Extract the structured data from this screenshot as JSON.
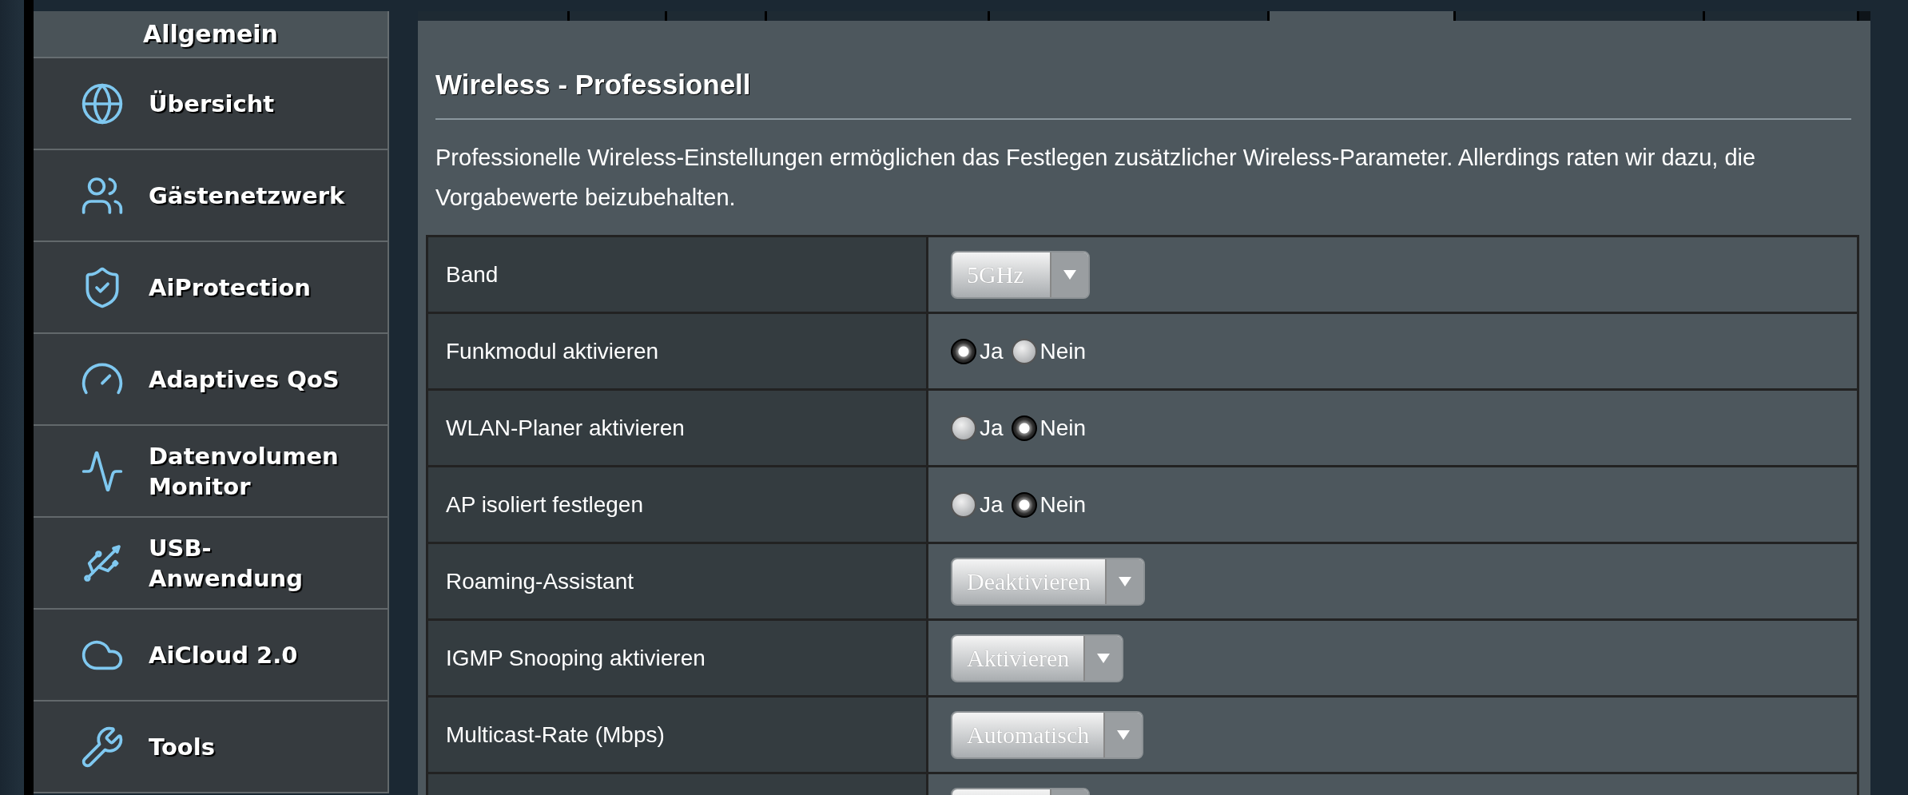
{
  "sidebar": {
    "header": "Allgemein",
    "items": [
      {
        "label": "Übersicht"
      },
      {
        "label": "Gästenetzwerk"
      },
      {
        "label": "AiProtection"
      },
      {
        "label": "Adaptives QoS"
      },
      {
        "label": "Datenvolumen Monitor"
      },
      {
        "label": "USB-Anwendung"
      },
      {
        "label": "AiCloud 2.0"
      },
      {
        "label": "Tools"
      }
    ]
  },
  "tabs": [
    {
      "selected": false
    },
    {
      "selected": false
    },
    {
      "selected": false
    },
    {
      "selected": false
    },
    {
      "selected": false
    },
    {
      "selected": true
    },
    {
      "selected": false
    },
    {
      "selected": false
    }
  ],
  "panel": {
    "title": "Wireless - Professionell",
    "description": "Professionelle Wireless-Einstellungen ermöglichen das Festlegen zusätzlicher Wireless-Parameter. Allerdings raten wir dazu, die Vorgabewerte beizubehalten.",
    "rows": [
      {
        "kind": "select",
        "label": "Band",
        "value": "5GHz"
      },
      {
        "kind": "radio",
        "label": "Funkmodul aktivieren",
        "options": [
          {
            "label": "Ja",
            "selected": true
          },
          {
            "label": "Nein",
            "selected": false
          }
        ]
      },
      {
        "kind": "radio",
        "label": "WLAN-Planer aktivieren",
        "options": [
          {
            "label": "Ja",
            "selected": false
          },
          {
            "label": "Nein",
            "selected": true
          }
        ]
      },
      {
        "kind": "radio",
        "label": "AP isoliert festlegen",
        "options": [
          {
            "label": "Ja",
            "selected": false
          },
          {
            "label": "Nein",
            "selected": true
          }
        ]
      },
      {
        "kind": "select",
        "label": "Roaming-Assistant",
        "value": "Deaktivieren"
      },
      {
        "kind": "select",
        "label": "IGMP Snooping aktivieren",
        "value": "Aktivieren"
      },
      {
        "kind": "select",
        "label": "Multicast-Rate (Mbps)",
        "value": "Automatisch"
      },
      {
        "kind": "select"
      }
    ]
  }
}
